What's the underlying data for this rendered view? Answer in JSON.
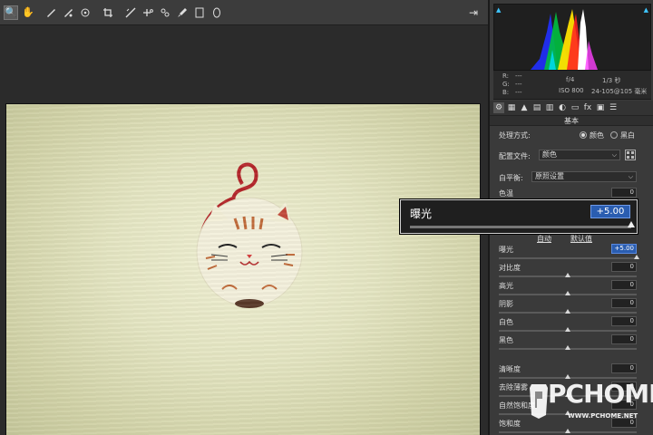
{
  "toolbar": {
    "tools": [
      {
        "name": "zoom-icon",
        "glyph": "🔍"
      },
      {
        "name": "hand-icon",
        "glyph": "✋"
      },
      {
        "name": "white-balance-icon",
        "glyph": "⁄"
      },
      {
        "name": "color-sampler-icon",
        "glyph": "⁄"
      },
      {
        "name": "target-adjust-icon",
        "glyph": "◎"
      },
      {
        "name": "crop-icon",
        "glyph": "⌗"
      },
      {
        "name": "straighten-icon",
        "glyph": "⟋"
      },
      {
        "name": "spot-removal-icon",
        "glyph": "✚"
      },
      {
        "name": "redeye-icon",
        "glyph": "✧"
      },
      {
        "name": "brush-icon",
        "glyph": "/"
      },
      {
        "name": "radial-filter-icon",
        "glyph": "◯"
      }
    ],
    "exit_glyph": "⇥"
  },
  "histogram": {
    "clip_shadow": "▲",
    "clip_highlight": "▲"
  },
  "camera_info": {
    "r_label": "R:",
    "r_val": "---",
    "g_label": "G:",
    "g_val": "---",
    "b_label": "B:",
    "b_val": "---",
    "aperture": "f/4",
    "shutter": "1/3 秒",
    "iso": "ISO 800",
    "lens": "24-105@105 毫米"
  },
  "panel_tabs": [
    "⚙",
    "▦",
    "▲",
    "▤",
    "▥",
    "◐",
    "▭",
    "fx",
    "▣",
    "☰"
  ],
  "section_title": "基本",
  "treatment": {
    "label": "处理方式:",
    "color": "颜色",
    "bw": "黑白"
  },
  "profile": {
    "label": "配置文件:",
    "value": "颜色"
  },
  "white_balance": {
    "label": "白平衡:",
    "value": "原照设置"
  },
  "sliders_top": [
    {
      "label": "色温",
      "value": "0"
    },
    {
      "label": "色调",
      "value": "0"
    }
  ],
  "auto_label": "自动",
  "default_label": "默认值",
  "sliders": [
    {
      "label": "曝光",
      "value": "+5.00",
      "pos": 1.0
    },
    {
      "label": "对比度",
      "value": "0",
      "pos": 0.5
    },
    {
      "label": "高光",
      "value": "0",
      "pos": 0.5
    },
    {
      "label": "阴影",
      "value": "0",
      "pos": 0.5
    },
    {
      "label": "白色",
      "value": "0",
      "pos": 0.5
    },
    {
      "label": "黑色",
      "value": "0",
      "pos": 0.5
    }
  ],
  "presence": [
    {
      "label": "清晰度",
      "value": "0",
      "pos": 0.5
    },
    {
      "label": "去除薄雾",
      "value": "0",
      "pos": 0.5
    },
    {
      "label": "自然饱和度",
      "value": "0",
      "pos": 0.5
    },
    {
      "label": "饱和度",
      "value": "0",
      "pos": 0.5
    }
  ],
  "popup": {
    "label": "曝光",
    "value": "+5.00",
    "pos": 1.0
  },
  "watermark": {
    "text": "PCHOME",
    "url": "WWW.PCHOME.NET"
  }
}
